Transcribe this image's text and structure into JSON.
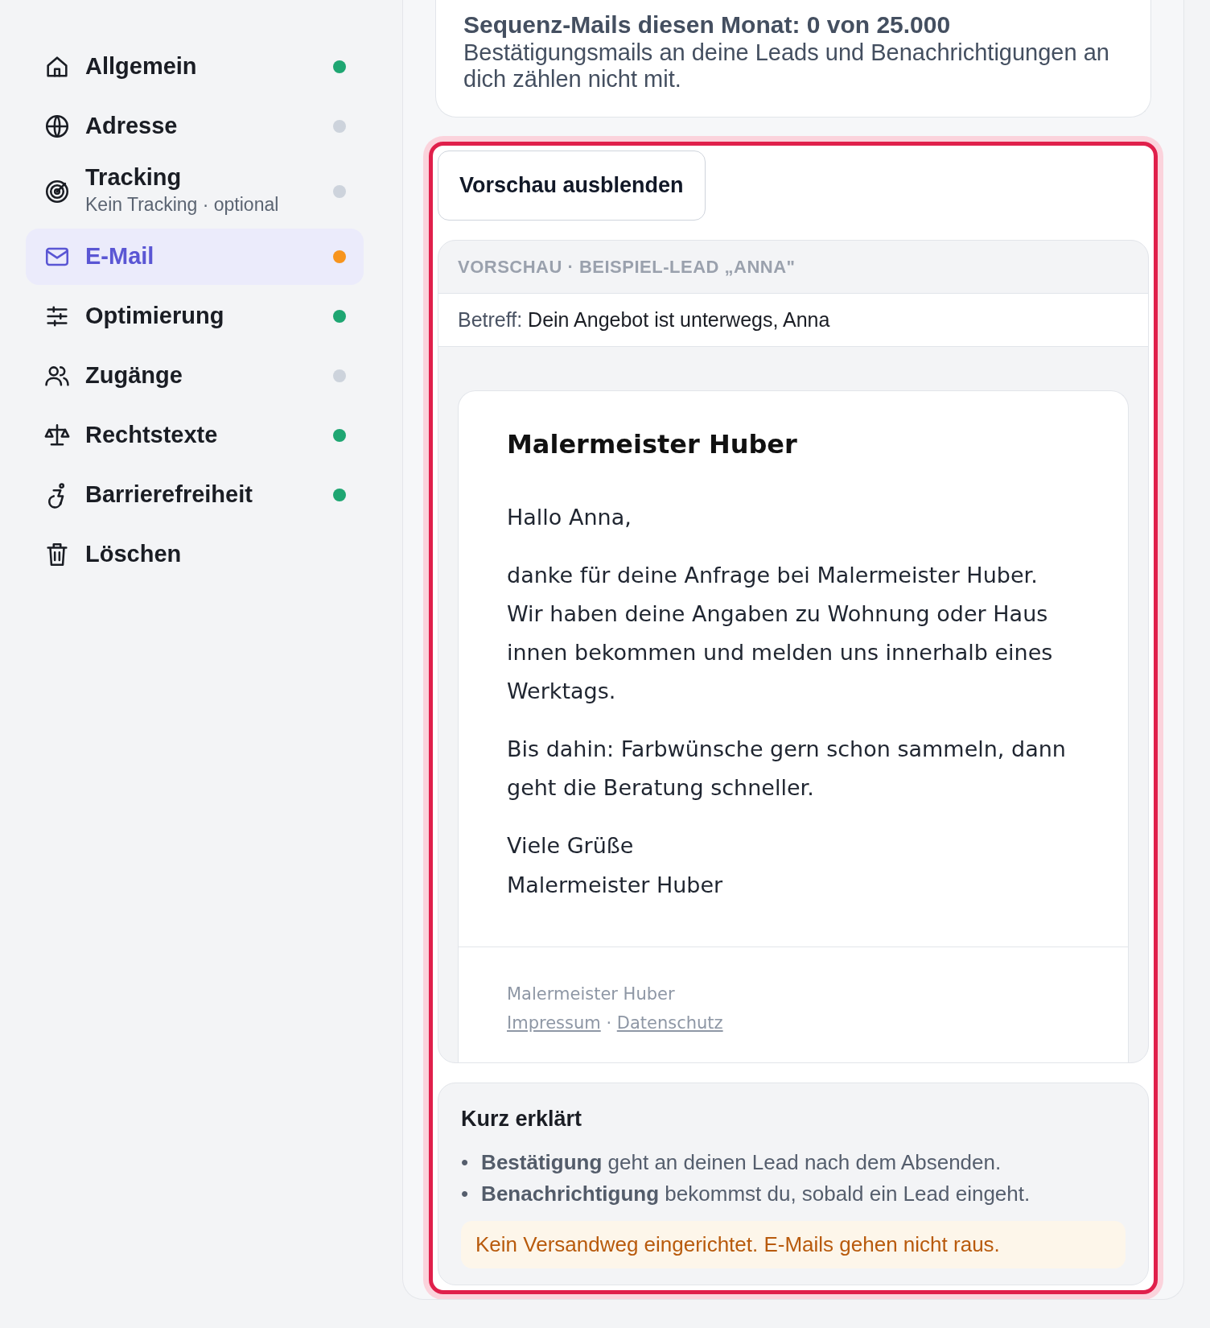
{
  "sidebar": {
    "items": [
      {
        "label": "Allgemein",
        "selected": false,
        "color": "#1ea672"
      },
      {
        "label": "Adresse",
        "selected": false,
        "color": "#cdd3dc"
      },
      {
        "label": "Tracking",
        "sublabel": "Kein Tracking · optional",
        "selected": false,
        "color": "#cdd3dc"
      },
      {
        "label": "E-Mail",
        "selected": true,
        "color": "#f7941d"
      },
      {
        "label": "Optimierung",
        "selected": false,
        "color": "#1ea672"
      },
      {
        "label": "Zugänge",
        "selected": false,
        "color": "#cdd3dc"
      },
      {
        "label": "Rechtstexte",
        "selected": false,
        "color": "#1ea672"
      },
      {
        "label": "Barrierefreiheit",
        "selected": false,
        "color": "#1ea672"
      },
      {
        "label": "Löschen",
        "selected": false
      }
    ]
  },
  "usage_card": {
    "counter": "Sequenz-Mails diesen Monat: 0 von 25.000",
    "note": "Bestätigungsmails an deine Leads und Benachrichtigungen an dich zählen nicht mit."
  },
  "preview": {
    "highlighted": true,
    "toggle_button": "Vorschau ausblenden",
    "header": "VORSCHAU · BEISPIEL-LEAD „ANNA\"",
    "subject_label": "Betreff:",
    "subject": "Dein Angebot ist unterwegs, Anna",
    "email": {
      "sender": "Malermeister Huber",
      "paragraphs": [
        [
          "Hallo Anna,"
        ],
        [
          "danke für deine Anfrage bei Malermeister Huber. Wir haben deine Angaben zu Wohnung oder Haus innen bekommen und melden uns innerhalb eines Werktags."
        ],
        [
          "Bis dahin: Farbwünsche gern schon sammeln, dann geht die Beratung schneller."
        ],
        [
          "Viele Grüße",
          "Malermeister Huber"
        ]
      ],
      "footer": {
        "company": "Malermeister Huber",
        "links": [
          "Impressum",
          "Datenschutz"
        ],
        "separator": "·"
      }
    }
  },
  "explainer": {
    "title": "Kurz erklärt",
    "marker": "•",
    "items": [
      "**Bestätigung** geht an deinen Lead nach dem Absenden.",
      "**Benachrichtigung** bekommst du, sobald ein Lead eingeht."
    ],
    "warning": "Kein Versandweg eingerichtet. E-Mails gehen nicht raus."
  }
}
